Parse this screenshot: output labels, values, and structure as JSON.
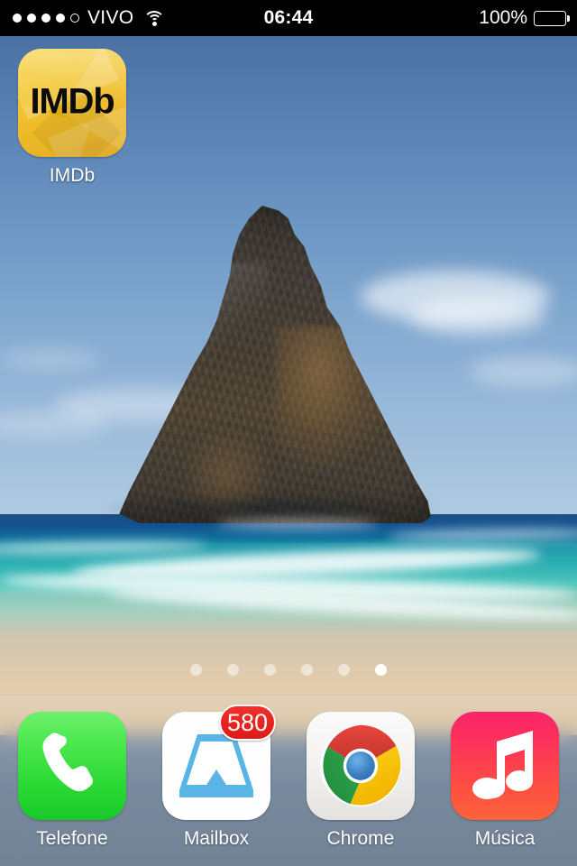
{
  "status_bar": {
    "signal_dots_total": 5,
    "signal_dots_filled": 4,
    "carrier": "VIVO",
    "wifi_icon": "wifi-icon",
    "time": "06:44",
    "battery_percent": "100%",
    "battery_level": 100,
    "battery_icon": "battery-full-icon",
    "background_color": "#000000",
    "text_color": "#ffffff"
  },
  "wallpaper": {
    "description": "beach with rock formation",
    "sky_color": "#5a83b4",
    "ocean_color": "#14528f",
    "sand_color": "#ddc9ab"
  },
  "home_screen": {
    "apps": [
      {
        "name": "IMDb",
        "label": "IMDb",
        "icon": "imdb-icon",
        "icon_text": "IMDb",
        "icon_bg_color": "#ecb30c",
        "icon_text_color": "#0b0b0b"
      }
    ]
  },
  "page_dots": {
    "total": 6,
    "active_index": 5,
    "inactive_color": "rgba(255,255,255,0.50)",
    "active_color": "#ffffff"
  },
  "dock": {
    "apps": [
      {
        "name": "Telefone",
        "label": "Telefone",
        "icon": "phone-icon",
        "icon_bg_color": "#2ad832",
        "badge": null
      },
      {
        "name": "Mailbox",
        "label": "Mailbox",
        "icon": "mailbox-icon",
        "icon_bg_color": "#fefefe",
        "icon_glyph_color": "#5ab4e5",
        "badge": "580",
        "badge_color": "#dd1a16"
      },
      {
        "name": "Chrome",
        "label": "Chrome",
        "icon": "chrome-icon",
        "icon_bg_color": "#f1f0ee",
        "badge": null
      },
      {
        "name": "Música",
        "label": "Música",
        "icon": "music-note-icon",
        "icon_bg_color": "#fb3457",
        "badge": null
      }
    ]
  }
}
